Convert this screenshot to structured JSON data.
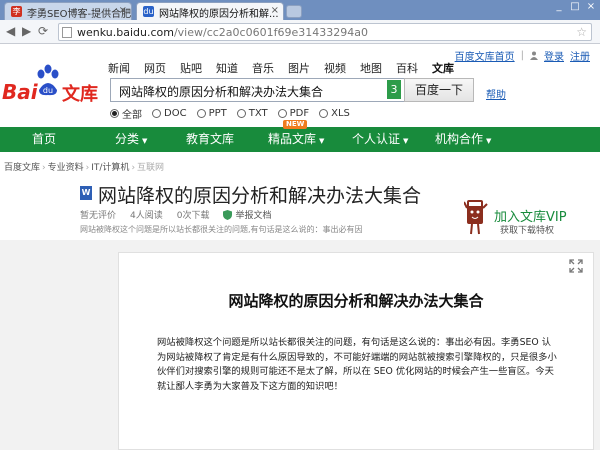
{
  "browser": {
    "tabs": [
      {
        "label": "李勇SEO博客-提供合肥SEO..."
      },
      {
        "label": "网站降权的原因分析和解..."
      }
    ],
    "url_host": "wenku.baidu.com",
    "url_path": "/view/cc2a0c0601f69e31433294a0"
  },
  "header": {
    "top_links": {
      "home": "百度文库首页",
      "login": "登录",
      "register": "注册"
    },
    "logo_text_left": "Bai",
    "logo_text_right": "文库",
    "channels": [
      "新闻",
      "网页",
      "贴吧",
      "知道",
      "音乐",
      "图片",
      "视频",
      "地图",
      "百科",
      "文库"
    ],
    "search_query": "网站降权的原因分析和解决办法大集合",
    "suggestion_count": "3",
    "search_button": "百度一下",
    "help": "帮助",
    "filetypes": [
      "全部",
      "DOC",
      "PPT",
      "TXT",
      "PDF",
      "XLS"
    ]
  },
  "nav": {
    "items": [
      "首页",
      "分类",
      "教育文库",
      "精品文库",
      "个人认证",
      "机构合作"
    ],
    "new_badge": "NEW"
  },
  "breadcrumb": [
    "百度文库",
    "专业资料",
    "IT/计算机",
    "互联网"
  ],
  "doc": {
    "type_icon": "W",
    "title": "网站降权的原因分析和解决办法大集合",
    "rating": "暂无评价",
    "readers": "4人阅读",
    "downloads": "0次下载",
    "report": "举报文档",
    "summary": "网站被降权这个问题是所以站长都很关注的问题,有句话是这么说的：事出必有因"
  },
  "vip": {
    "title": "加入文库VIP",
    "subtitle": "获取下载特权"
  },
  "page": {
    "heading": "网站降权的原因分析和解决办法大集合",
    "body": "网站被降权这个问题是所以站长都很关注的问题，有句话是这么说的：事出必有因。李勇SEO 认为网站被降权了肯定是有什么原因导致的，不可能好端端的网站就被搜索引擎降权的，只是很多小伙伴们对搜索引擎的规则可能还不是太了解，所以在 SEO 优化网站的时候会产生一些盲区。今天就让鄙人李勇为大家普及下这方面的知识吧！"
  },
  "colors": {
    "accent_green": "#188b3c",
    "baidu_red": "#e0281f",
    "link_blue": "#1a5bb5"
  }
}
